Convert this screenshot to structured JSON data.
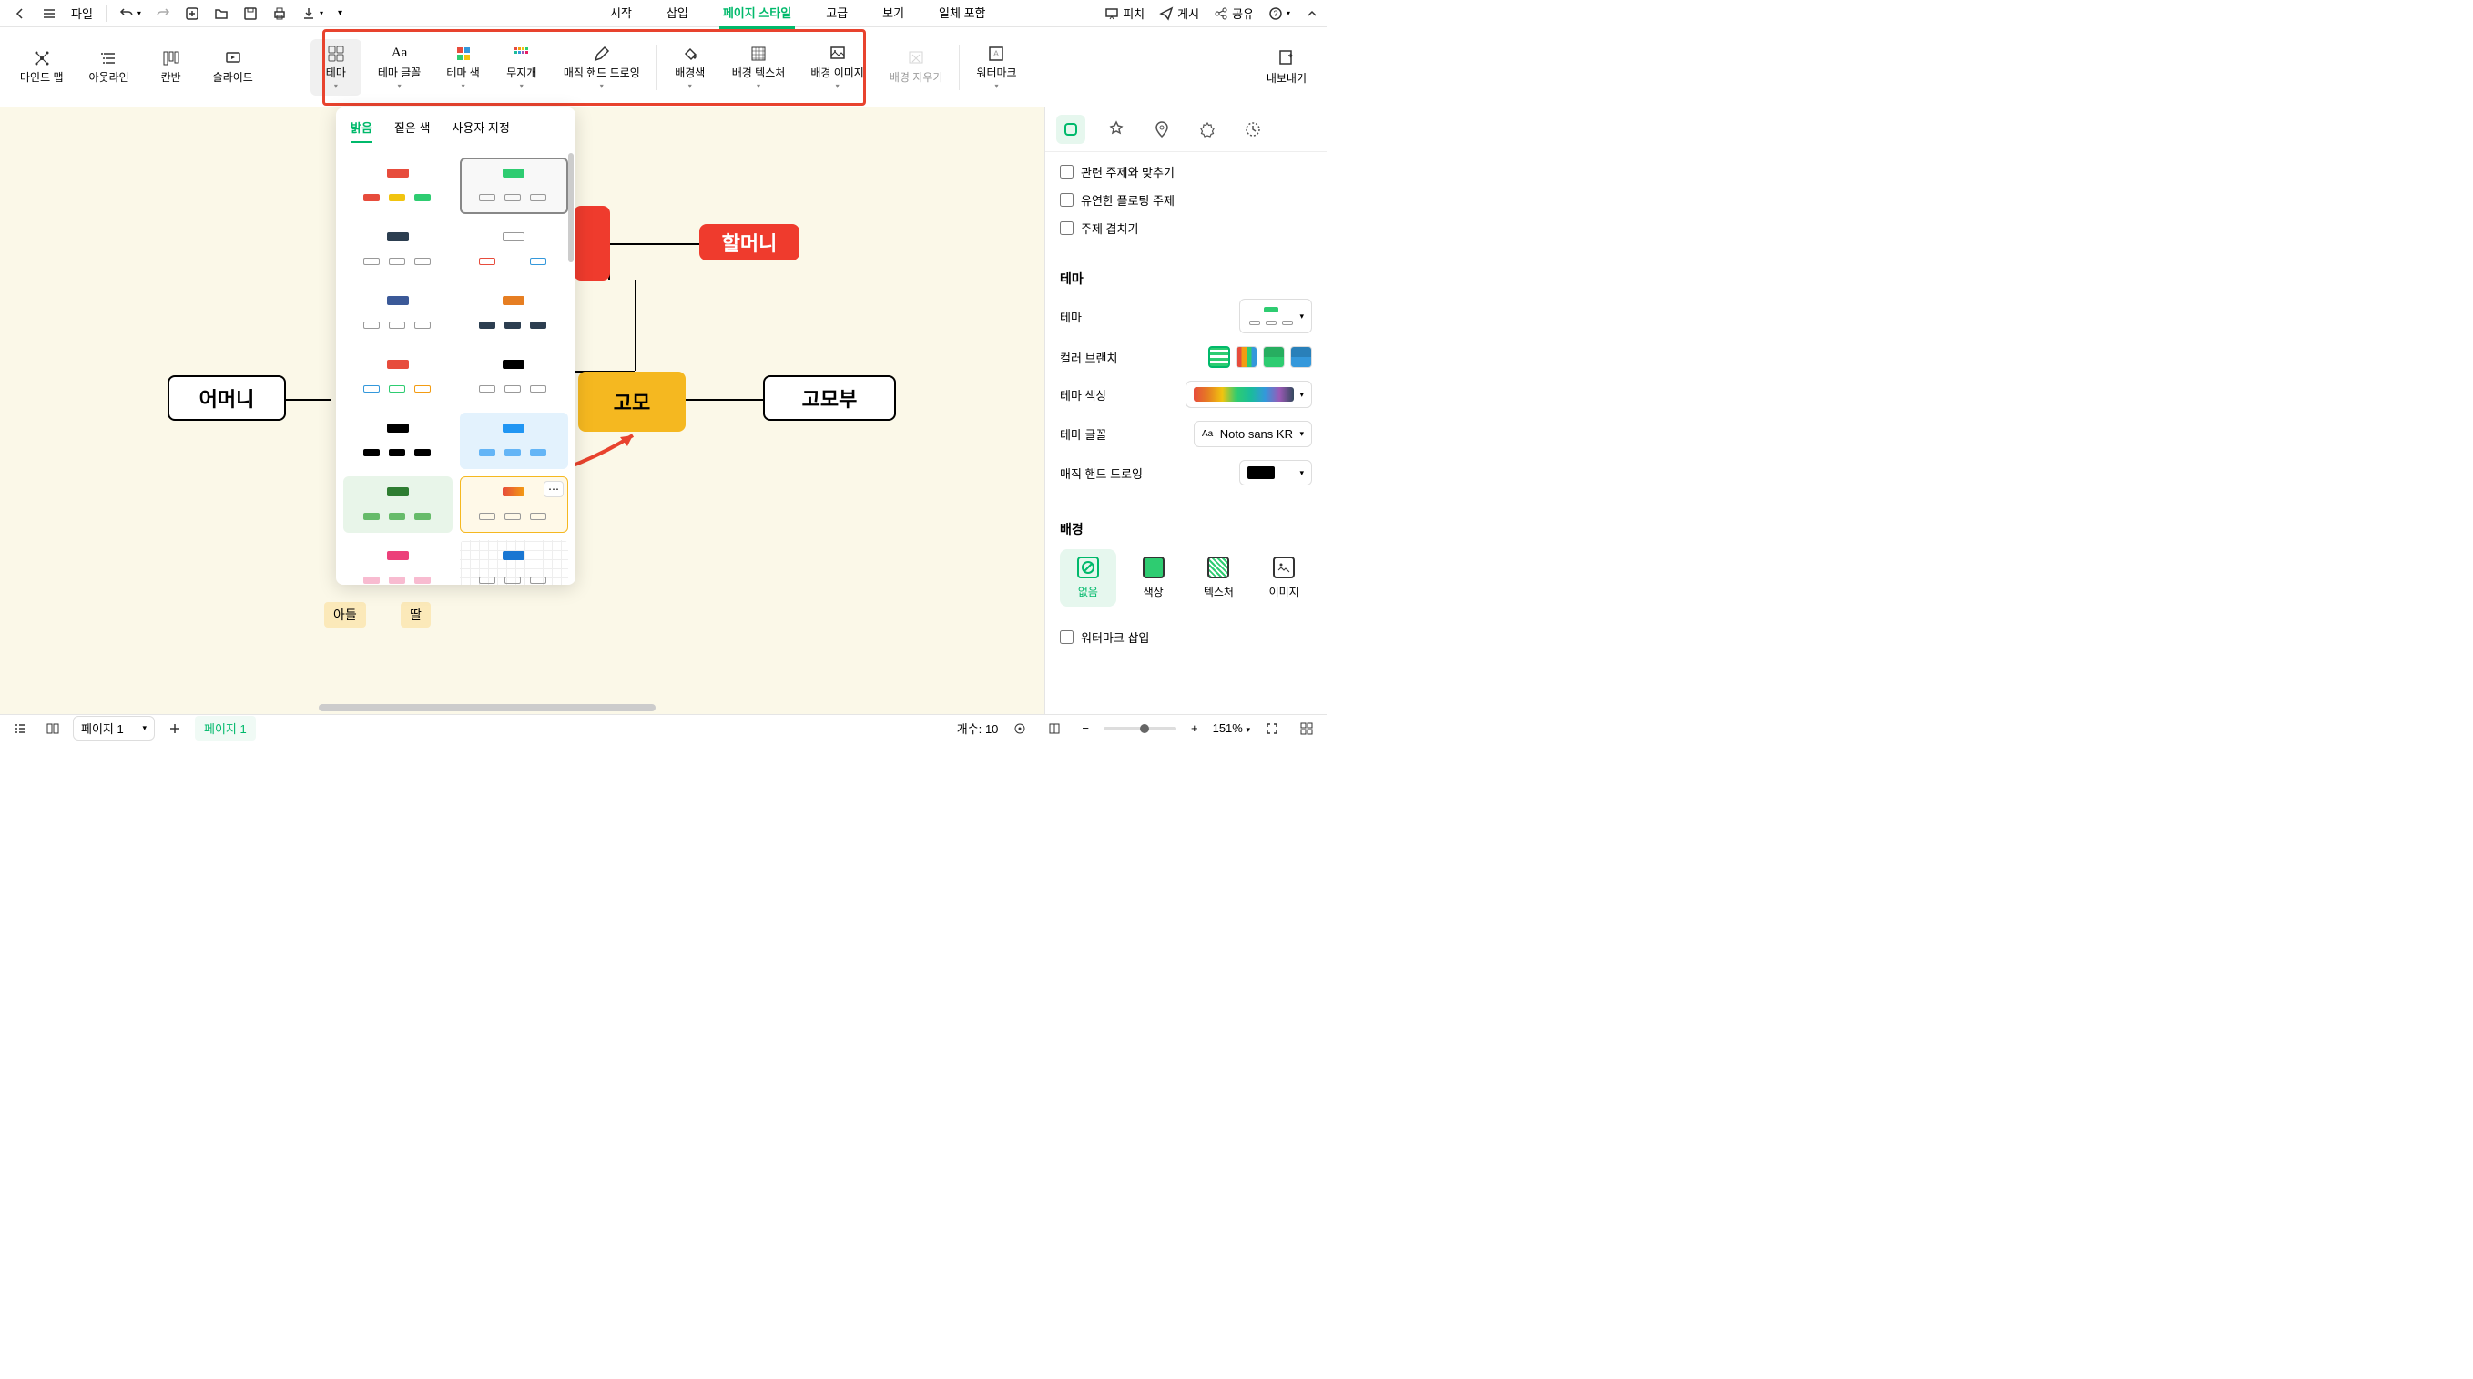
{
  "top": {
    "file": "파일",
    "tabs": [
      "시작",
      "삽입",
      "페이지 스타일",
      "고급",
      "보기",
      "일체 포함"
    ],
    "active_tab": "페이지 스타일",
    "pitch": "피치",
    "publish": "게시",
    "share": "공유"
  },
  "ribbon": {
    "view_modes": [
      "마인드 맵",
      "아웃라인",
      "칸반",
      "슬라이드"
    ],
    "theme": "테마",
    "theme_font": "테마 글꼴",
    "theme_color": "테마 색",
    "rainbow": "무지개",
    "magic_hand": "매직 핸드 드로잉",
    "bg_color": "배경색",
    "bg_texture": "배경 텍스처",
    "bg_image": "배경 이미지",
    "bg_clear": "배경 지우기",
    "watermark": "워터마크",
    "export": "내보내기"
  },
  "theme_dropdown": {
    "tabs": [
      "밝음",
      "짙은 색",
      "사용자 지정"
    ],
    "active_tab": "밝음"
  },
  "canvas": {
    "nodes": {
      "mother": "어머니",
      "grandmother": "할머니",
      "aunt": "고모",
      "uncle": "고모부",
      "son": "아들",
      "daughter": "딸"
    }
  },
  "right_panel": {
    "checks": {
      "align_related": "관련 주제와 맞추기",
      "flexible_floating": "유연한 플로팅 주제",
      "overlap_topics": "주제 겹치기",
      "insert_watermark": "워터마크 삽입"
    },
    "sections": {
      "theme_title": "테마",
      "theme_label": "테마",
      "color_branch": "컬러 브랜치",
      "theme_color": "테마 색상",
      "theme_font": "테마 글꼴",
      "theme_font_value": "Noto sans KR",
      "magic_hand": "매직 핸드 드로잉",
      "bg_title": "배경",
      "bg_none": "없음",
      "bg_color": "색상",
      "bg_texture": "텍스처",
      "bg_image": "이미지"
    }
  },
  "status": {
    "page_dropdown": "페이지 1",
    "page_tab": "페이지 1",
    "count_label": "개수:",
    "count_value": "10",
    "zoom": "151%"
  }
}
